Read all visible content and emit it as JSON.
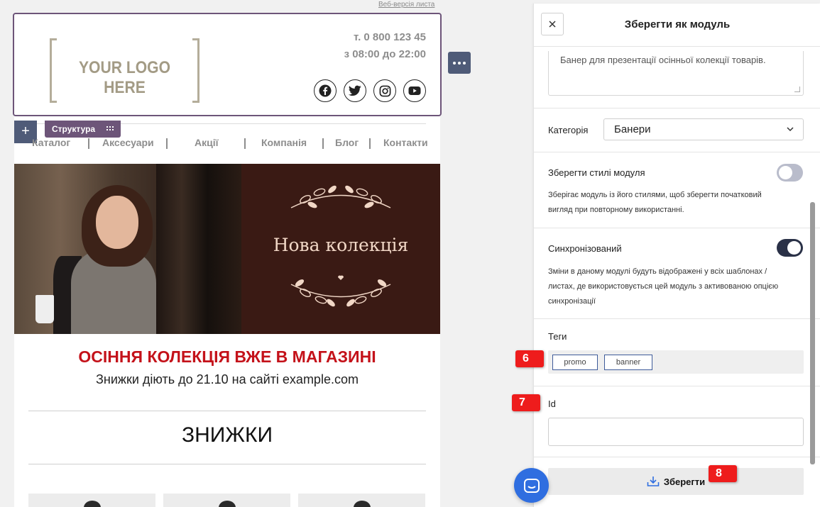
{
  "email": {
    "web_version_link": "Веб-версія листа",
    "logo_text": "YOUR LOGO HERE",
    "phone": "т. 0 800 123 45",
    "hours": "з 08:00 до 22:00",
    "social_icons": [
      "facebook-icon",
      "twitter-icon",
      "instagram-icon",
      "youtube-icon"
    ],
    "structure_tag": "Структура",
    "add_button": "+",
    "nav_items": [
      "Каталог",
      "Аксесуари",
      "Акції",
      "Компанія",
      "Блог",
      "Контакти"
    ],
    "banner_title": "Нова колекція",
    "promo_title": "ОСІННЯ КОЛЕКЦІЯ ВЖЕ В МАГАЗИНІ",
    "promo_subtitle": "Знижки діють до 21.10 на сайті example.com",
    "section_title": "ЗНИЖКИ"
  },
  "panel": {
    "title": "Зберегти як модуль",
    "description": "Банер для презентації осінньої колекції товарів.",
    "category_label": "Категорія",
    "category_value": "Банери",
    "save_styles_label": "Зберегти стилі модуля",
    "save_styles_enabled": false,
    "save_styles_hint_1": "Зберігає модуль із його стилями, щоб зберегти початковий",
    "save_styles_hint_2": "вигляд при повторному використанні.",
    "sync_label": "Синхронізований",
    "sync_enabled": true,
    "sync_hint_1": "Зміни в даному модулі будуть відображені у всіх шаблонах /",
    "sync_hint_2": "листах, де використовується цей модуль з активованою опцією",
    "sync_hint_3": "синхронізації",
    "tags_label": "Теги",
    "tags": [
      "promo",
      "banner"
    ],
    "id_label": "Id",
    "id_value": "",
    "save_button": "Зберегти"
  },
  "markers": [
    "6",
    "7",
    "8"
  ],
  "colors": {
    "accent_dark": "#4f5b78",
    "structure_purple": "#6d5579",
    "promo_red": "#c4121a",
    "toggle_on": "#2a3147",
    "toggle_off": "#b9bccb",
    "marker_red": "#ee1c1c",
    "chat_blue": "#2f6ee0"
  }
}
